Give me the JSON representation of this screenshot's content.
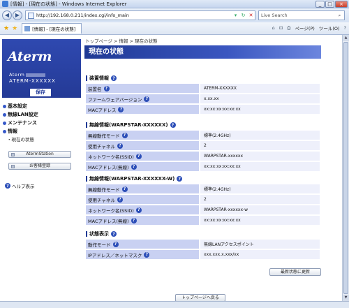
{
  "window": {
    "title": "[情報] - [現在の状態] - Windows Internet Explorer",
    "min": "_",
    "max": "□",
    "close": "×"
  },
  "address": {
    "url": "http://192.168.0.211/index.cgi/info_main",
    "search_placeholder": "Live Search"
  },
  "tab": {
    "label": "[情報] - [現在の状態]"
  },
  "tools": {
    "home": "⌂",
    "feed": "⊡",
    "print": "⎙",
    "page": "ページ(P)",
    "tools": "ツール(O)",
    "help": "?"
  },
  "sidebar": {
    "logo_text": "Aterm",
    "model_prefix": "Aterm",
    "device_id": "ATERM-XXXXXX",
    "save": "保存",
    "menu": [
      {
        "label": "基本設定"
      },
      {
        "label": "無線LAN設定"
      },
      {
        "label": "メンテナンス"
      },
      {
        "label": "情報"
      }
    ],
    "submenu": "・現在の状態",
    "btn_station": "AtermStation",
    "btn_register": "お客様登録",
    "help": "ヘルプ表示"
  },
  "main": {
    "breadcrumb": "トップページ > 情報 > 現在の状態",
    "title": "現在の状態",
    "sections": [
      {
        "title": "装置情報",
        "rows": [
          {
            "k": "装置名",
            "v": "ATERM-XXXXXX"
          },
          {
            "k": "ファームウェアバージョン",
            "v": "x.xx.xx"
          },
          {
            "k": "MACアドレス",
            "v": "xx:xx:xx:xx:xx:xx"
          }
        ]
      },
      {
        "title": "無線情報(WARPSTAR-XXXXXX)",
        "rows": [
          {
            "k": "無線動作モード",
            "v": "標準(2.4GHz)"
          },
          {
            "k": "使用チャネル",
            "v": "2"
          },
          {
            "k": "ネットワーク名(SSID)",
            "v": "WARPSTAR-xxxxxx"
          },
          {
            "k": "MACアドレス(無線)",
            "v": "xx:xx:xx:xx:xx:xx"
          }
        ]
      },
      {
        "title": "無線情報(WARPSTAR-XXXXXX-W)",
        "rows": [
          {
            "k": "無線動作モード",
            "v": "標準(2.4GHz)"
          },
          {
            "k": "使用チャネル",
            "v": "2"
          },
          {
            "k": "ネットワーク名(SSID)",
            "v": "WARPSTAR-xxxxxx-w"
          },
          {
            "k": "MACアドレス(無線)",
            "v": "xx:xx:xx:xx:xx:xx"
          }
        ]
      },
      {
        "title": "状態表示",
        "rows": [
          {
            "k": "動作モード",
            "v": "無線LANアクセスポイント"
          },
          {
            "k": "IPアドレス／ネットマスク",
            "v": "xxx.xxx.x.xxx/xx"
          }
        ]
      }
    ],
    "refresh": "最新状態に更新",
    "back_top": "トップページへ戻る"
  },
  "colors": {
    "banner": "#1f3994",
    "label_bg": "#c9d1f2",
    "value_bg": "#eef0fb"
  }
}
